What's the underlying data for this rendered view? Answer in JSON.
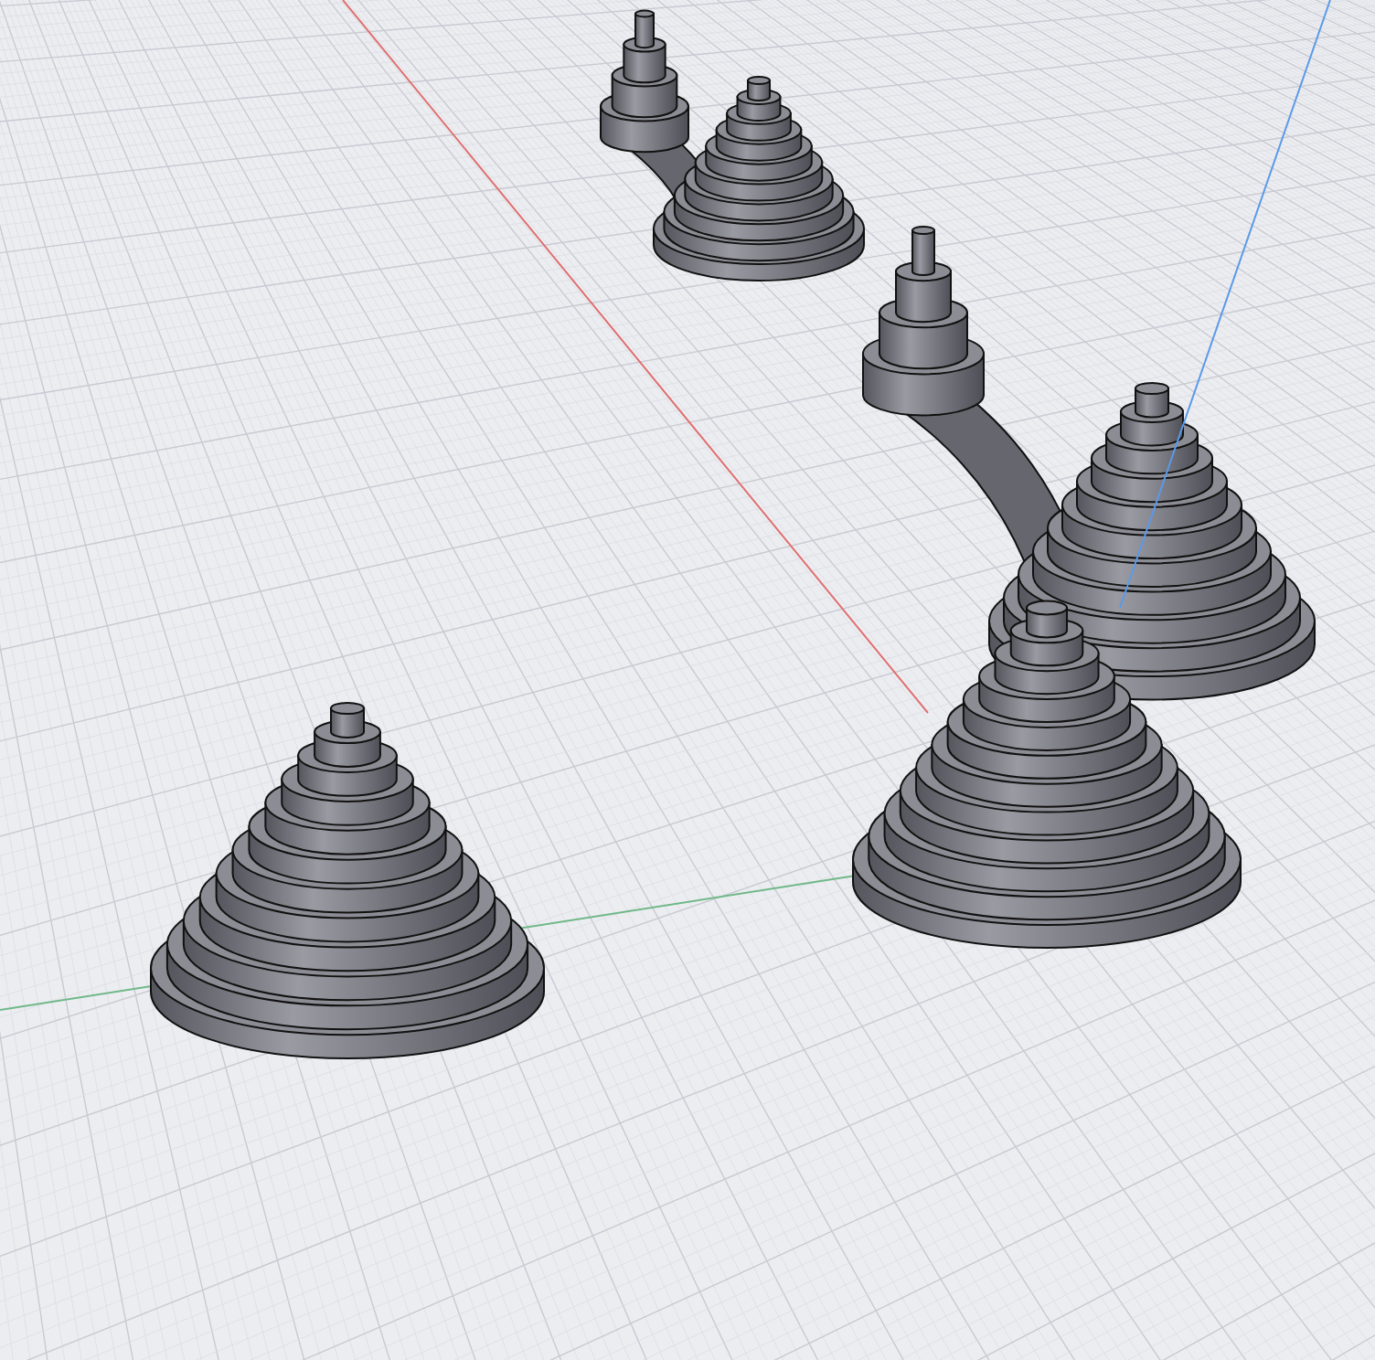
{
  "viewport": {
    "axes": [
      {
        "color": "#e07070"
      },
      {
        "color": "#70b888"
      },
      {
        "color": "#5a9ae8"
      }
    ],
    "objects": [
      {
        "kind": "tower-and-cone"
      },
      {
        "kind": "tower-and-cone"
      },
      {
        "kind": "stepped-cone"
      },
      {
        "kind": "stepped-cone"
      }
    ]
  }
}
